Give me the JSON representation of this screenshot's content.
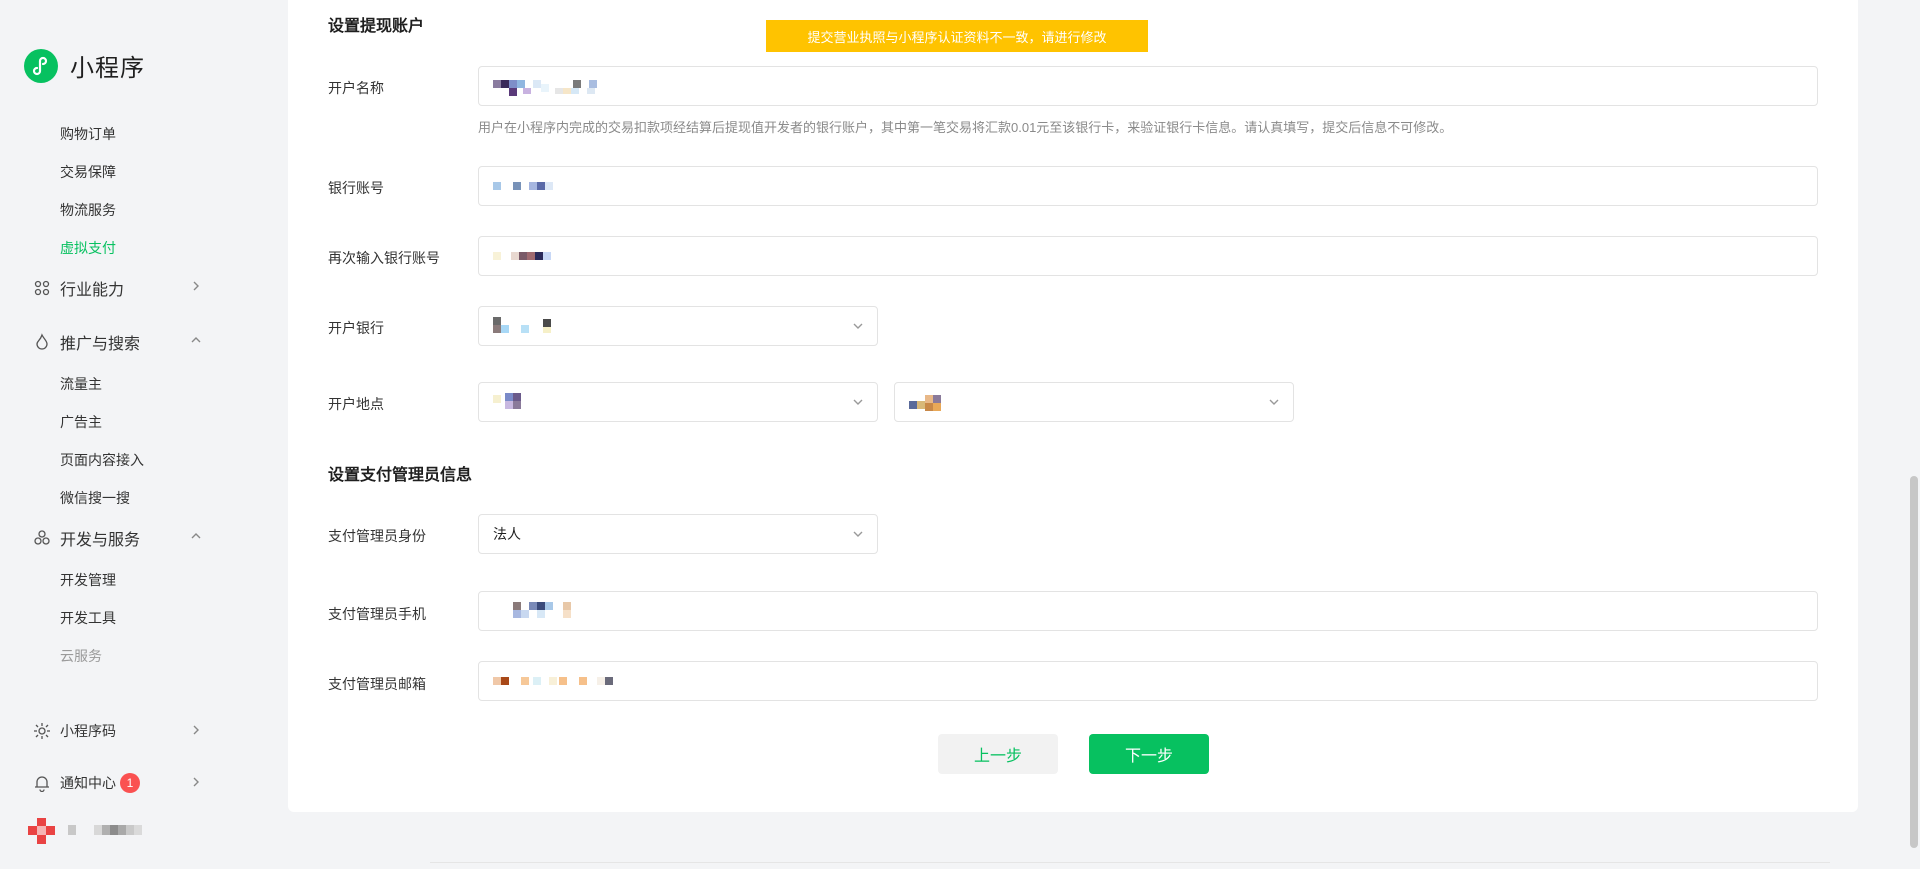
{
  "app": {
    "logo_text": "小程序"
  },
  "sidebar": {
    "sub_items_top": [
      {
        "label": "购物订单"
      },
      {
        "label": "交易保障"
      },
      {
        "label": "物流服务"
      },
      {
        "label": "虚拟支付",
        "active": true
      }
    ],
    "groups": [
      {
        "label": "行业能力",
        "icon": "industry-icon",
        "expanded": false
      },
      {
        "label": "推广与搜索",
        "icon": "flame-icon",
        "expanded": true
      },
      {
        "label": "开发与服务",
        "icon": "dev-service-icon",
        "expanded": true
      }
    ],
    "promo_items": [
      {
        "label": "流量主"
      },
      {
        "label": "广告主"
      },
      {
        "label": "页面内容接入"
      },
      {
        "label": "微信搜一搜"
      }
    ],
    "dev_items": [
      {
        "label": "开发管理"
      },
      {
        "label": "开发工具"
      },
      {
        "label": "云服务"
      }
    ],
    "bottom": {
      "code_label": "小程序码",
      "notify_label": "通知中心",
      "notify_count": "1"
    }
  },
  "toast": {
    "text": "提交营业执照与小程序认证资料不一致，请进行修改"
  },
  "withdraw": {
    "section_title": "设置提现账户",
    "account_name_label": "开户名称",
    "account_name_hint": "用户在小程序内完成的交易扣款项经结算后提现值开发者的银行账户，其中第一笔交易将汇款0.01元至该银行卡，来验证银行卡信息。请认真填写，提交后信息不可修改。",
    "bank_account_label": "银行账号",
    "bank_account_repeat_label": "再次输入银行账号",
    "bank_label": "开户银行",
    "location_label": "开户地点"
  },
  "admin": {
    "section_title": "设置支付管理员信息",
    "identity_label": "支付管理员身份",
    "identity_value": "法人",
    "phone_label": "支付管理员手机",
    "email_label": "支付管理员邮箱"
  },
  "actions": {
    "prev_label": "上一步",
    "next_label": "下一步"
  },
  "colors": {
    "brand": "#07c160",
    "warning": "#ffc300",
    "badge": "#fa5151"
  }
}
